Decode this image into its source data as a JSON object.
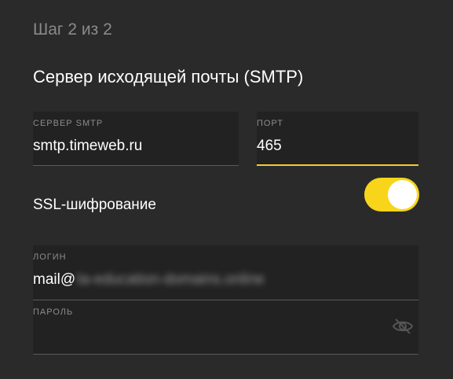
{
  "step": "Шаг 2 из 2",
  "title": "Сервер исходящей почты (SMTP)",
  "smtp_server": {
    "label": "СЕРВЕР SMTP",
    "value": "smtp.timeweb.ru"
  },
  "smtp_port": {
    "label": "ПОРТ",
    "value": "465"
  },
  "ssl": {
    "label": "SSL-шифрование",
    "enabled": true
  },
  "login": {
    "label": "ЛОГИН",
    "value_visible": "mail@",
    "value_obscured": "ta-education-domains.online"
  },
  "password": {
    "label": "ПАРОЛЬ",
    "value": ""
  },
  "colors": {
    "background": "#2a2a2a",
    "field_background": "#222222",
    "accent": "#f6cb2f",
    "toggle": "#f8d51a"
  },
  "icons": {
    "password_visibility": "eye-off-icon"
  }
}
